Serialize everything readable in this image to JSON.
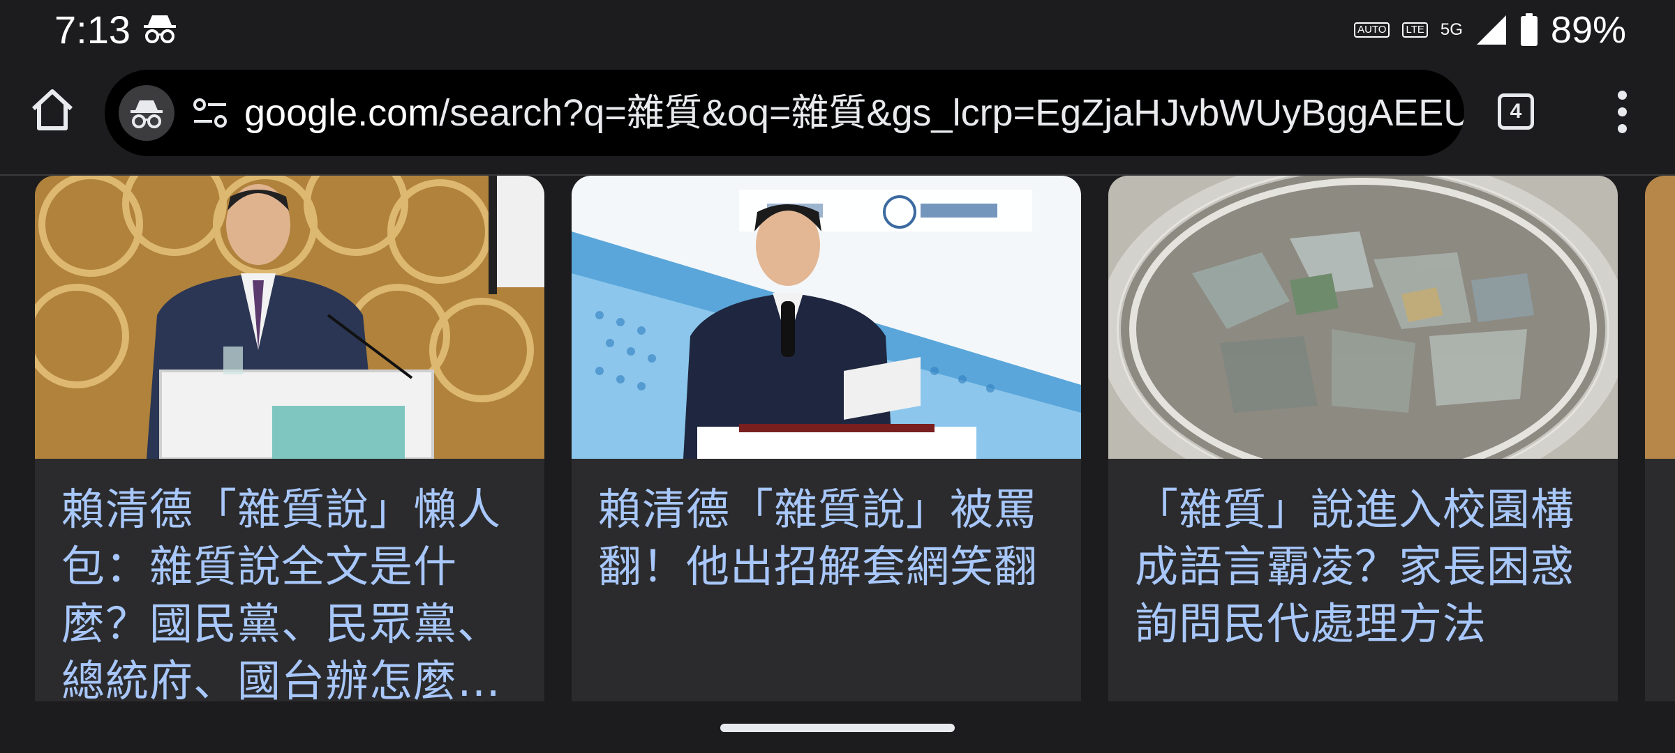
{
  "status_bar": {
    "time": "7:13",
    "icons": [
      "incognito-icon",
      "auto-hz-icon",
      "vo-lte-icon",
      "signal-icon",
      "battery-icon"
    ],
    "auto_badge": "AUTO",
    "lte_badge": "LTE",
    "network": "5G",
    "battery_percent": "89%"
  },
  "toolbar": {
    "url_host": "google.com",
    "url_rest": "/search?q=雜質&oq=雜質&gs_lcrp=EgZjaHJvbWUyBggAEEU",
    "tab_count": "4"
  },
  "cards": [
    {
      "title": "賴清德「雜質說」懶人包：雜質說全文是什麼？國民黨、民眾黨、總統府、國台辦怎麼說？",
      "image_icon": "photo-speaker-at-podium"
    },
    {
      "title": "賴清德「雜質說」被罵翻！他出招解套網笑翻",
      "image_icon": "photo-speaker-with-microphone"
    },
    {
      "title": "「雜質」說進入校園構成語言霸凌？家長困惑詢問民代處理方法",
      "image_icon": "photo-jar-of-debris"
    }
  ],
  "colors": {
    "background": "#1c1c1e",
    "card": "#2b2b2d",
    "link": "#a8c7fa",
    "omnibox": "#000000"
  }
}
